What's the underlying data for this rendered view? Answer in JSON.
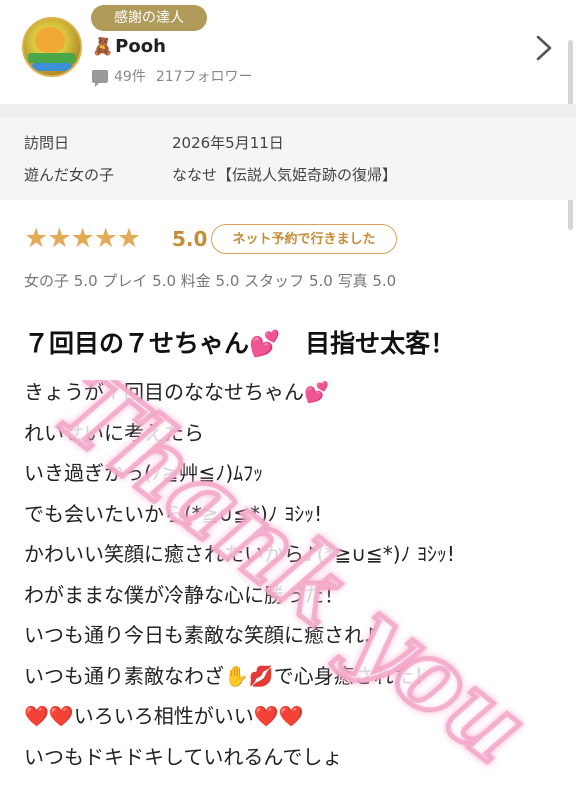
{
  "reviewer": {
    "badge": "感謝の達人",
    "name": "Pooh",
    "name_icon": "teddy-bear-icon",
    "review_count": "49件",
    "followers": "217フォロワー"
  },
  "visit": {
    "date_label": "訪問日",
    "date_value": "2026年5月11日",
    "girl_label": "遊んだ女の子",
    "girl_value": "ななせ【伝説人気姫奇跡の復帰】"
  },
  "rating": {
    "stars": 5,
    "score": "5.0",
    "booking_tag": "ネット予約で行きました",
    "subscores": "女の子 5.0 プレイ 5.0 料金 5.0 スタッフ 5.0 写真 5.0",
    "star_color": "#e3ab55"
  },
  "review": {
    "title": "７回目の７せちゃん💕　目指せ太客！",
    "lines": [
      "きょうが７回目のななせちゃん💕",
      "れいせいに考えたら",
      "いき過ぎかっ(ﾉ≧艸≦ﾉ)ﾑﾌｯ",
      "でも会いたいから(*≧∪≦*)ﾉ ﾖｼｯ!",
      "かわいい笑顔に癒されたいから♪(*≧∪≦*)ﾉ ﾖｼｯ!",
      "わがままな僕が冷静な心に勝った！",
      "いつも通り今日も素敵な笑顔に癒され♪",
      "いつも通り素敵なわざ✋💋で心身癒された！",
      "❤️❤️いろいろ相性がいい❤️❤️",
      "いつもドキドキしていれるんでしょ"
    ]
  },
  "watermark": {
    "text": "Thank you",
    "color": "#f3a6c8"
  }
}
